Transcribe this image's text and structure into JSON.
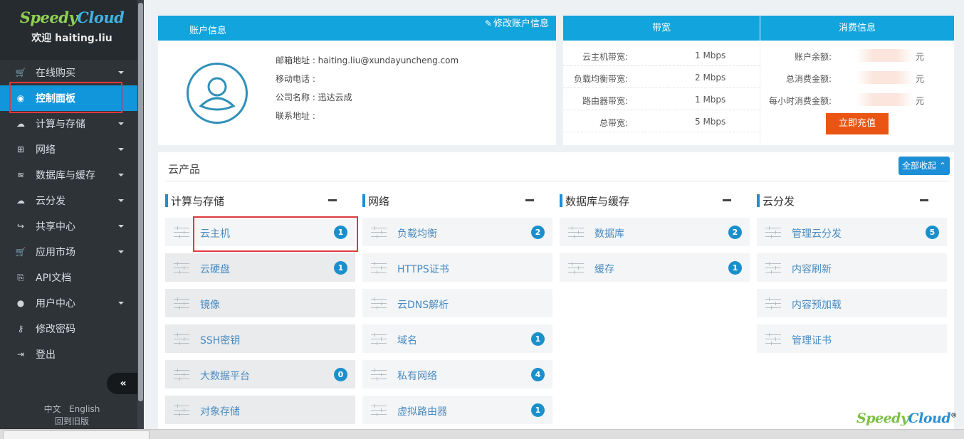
{
  "brand": {
    "logo_part1": "Speedy",
    "logo_part2": "Cloud",
    "welcome": "欢迎 haiting.liu"
  },
  "sidebar": {
    "items": [
      {
        "label": "在线购买",
        "icon": "cart-icon",
        "has_caret": true
      },
      {
        "label": "控制面板",
        "icon": "dashboard-icon",
        "has_caret": false,
        "active": true
      },
      {
        "label": "计算与存储",
        "icon": "cloud-icon",
        "has_caret": true
      },
      {
        "label": "网络",
        "icon": "network-icon",
        "has_caret": true
      },
      {
        "label": "数据库与缓存",
        "icon": "database-icon",
        "has_caret": true
      },
      {
        "label": "云分发",
        "icon": "cloud-upload-icon",
        "has_caret": true
      },
      {
        "label": "共享中心",
        "icon": "share-icon",
        "has_caret": true
      },
      {
        "label": "应用市场",
        "icon": "cart-icon",
        "has_caret": true
      },
      {
        "label": "API文档",
        "icon": "copy-icon",
        "has_caret": false
      },
      {
        "label": "用户中心",
        "icon": "user-icon",
        "has_caret": true
      },
      {
        "label": "修改密码",
        "icon": "key-icon",
        "has_caret": false
      },
      {
        "label": "登出",
        "icon": "logout-icon",
        "has_caret": false
      }
    ],
    "collapse_glyph": "«",
    "lang_zh": "中文",
    "lang_en": "English",
    "old_version": "回到旧版"
  },
  "account": {
    "title": "账户信息",
    "edit_label": "修改账户信息",
    "email": "邮箱地址 : haiting.liu@xundayuncheng.com",
    "mobile": "移动电话 :",
    "company": "公司名称 : 迅达云成",
    "address": "联系地址 :"
  },
  "bandwidth": {
    "title": "带宽",
    "rows": [
      {
        "label": "云主机带宽:",
        "value": "1 Mbps"
      },
      {
        "label": "负载均衡带宽:",
        "value": "2 Mbps"
      },
      {
        "label": "路由器带宽:",
        "value": "1 Mbps"
      },
      {
        "label": "总带宽:",
        "value": "5 Mbps"
      }
    ]
  },
  "cost": {
    "title": "消费信息",
    "rows": [
      {
        "label": "账户余额:",
        "unit": "元"
      },
      {
        "label": "总消费金额:",
        "unit": "元"
      },
      {
        "label": "每小时消费金额:",
        "unit": "元"
      }
    ],
    "recharge_label": "立即充值"
  },
  "products": {
    "title": "云产品",
    "collapse_all": "全部收起",
    "columns": [
      {
        "name": "计算与存储",
        "items": [
          {
            "label": "云主机",
            "badge": "1"
          },
          {
            "label": "云硬盘",
            "badge": "1"
          },
          {
            "label": "镜像",
            "badge": ""
          },
          {
            "label": "SSH密钥",
            "badge": ""
          },
          {
            "label": "大数据平台",
            "badge": "0"
          },
          {
            "label": "对象存储",
            "badge": ""
          }
        ]
      },
      {
        "name": "网络",
        "items": [
          {
            "label": "负载均衡",
            "badge": "2"
          },
          {
            "label": "HTTPS证书",
            "badge": ""
          },
          {
            "label": "云DNS解析",
            "badge": ""
          },
          {
            "label": "域名",
            "badge": "1"
          },
          {
            "label": "私有网络",
            "badge": "4"
          },
          {
            "label": "虚拟路由器",
            "badge": "1"
          }
        ]
      },
      {
        "name": "数据库与缓存",
        "items": [
          {
            "label": "数据库",
            "badge": "2"
          },
          {
            "label": "缓存",
            "badge": "1"
          }
        ]
      },
      {
        "name": "云分发",
        "items": [
          {
            "label": "管理云分发",
            "badge": "5"
          },
          {
            "label": "内容刷新",
            "badge": ""
          },
          {
            "label": "内容预加载",
            "badge": ""
          },
          {
            "label": "管理证书",
            "badge": ""
          }
        ]
      }
    ]
  },
  "footer_logo": {
    "part1": "Speedy",
    "part2": "Cloud",
    "mark": "®"
  }
}
